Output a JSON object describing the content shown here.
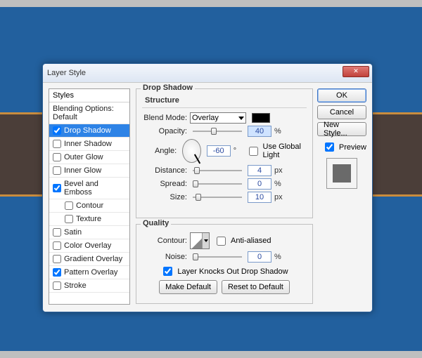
{
  "window": {
    "title": "Layer Style"
  },
  "styles": {
    "header": "Styles",
    "blending": "Blending Options: Default",
    "items": [
      {
        "label": "Drop Shadow",
        "checked": true,
        "selected": true
      },
      {
        "label": "Inner Shadow",
        "checked": false
      },
      {
        "label": "Outer Glow",
        "checked": false
      },
      {
        "label": "Inner Glow",
        "checked": false
      },
      {
        "label": "Bevel and Emboss",
        "checked": true
      },
      {
        "label": "Contour",
        "checked": false,
        "sub": true
      },
      {
        "label": "Texture",
        "checked": false,
        "sub": true
      },
      {
        "label": "Satin",
        "checked": false
      },
      {
        "label": "Color Overlay",
        "checked": false
      },
      {
        "label": "Gradient Overlay",
        "checked": false
      },
      {
        "label": "Pattern Overlay",
        "checked": true
      },
      {
        "label": "Stroke",
        "checked": false
      }
    ]
  },
  "panel": {
    "title": "Drop Shadow",
    "structure": {
      "legend": "Structure",
      "blend_mode_label": "Blend Mode:",
      "blend_mode_value": "Overlay",
      "color": "#000000",
      "opacity_label": "Opacity:",
      "opacity_value": "40",
      "opacity_unit": "%",
      "angle_label": "Angle:",
      "angle_value": "-60",
      "angle_unit": "°",
      "use_global_light": "Use Global Light",
      "use_global_light_checked": false,
      "distance_label": "Distance:",
      "distance_value": "4",
      "distance_unit": "px",
      "spread_label": "Spread:",
      "spread_value": "0",
      "spread_unit": "%",
      "size_label": "Size:",
      "size_value": "10",
      "size_unit": "px"
    },
    "quality": {
      "legend": "Quality",
      "contour_label": "Contour:",
      "anti_aliased": "Anti-aliased",
      "anti_aliased_checked": false,
      "noise_label": "Noise:",
      "noise_value": "0",
      "noise_unit": "%",
      "knocks_out": "Layer Knocks Out Drop Shadow",
      "knocks_out_checked": true,
      "make_default": "Make Default",
      "reset_default": "Reset to Default"
    }
  },
  "buttons": {
    "ok": "OK",
    "cancel": "Cancel",
    "new_style": "New Style...",
    "preview": "Preview",
    "preview_checked": true
  }
}
